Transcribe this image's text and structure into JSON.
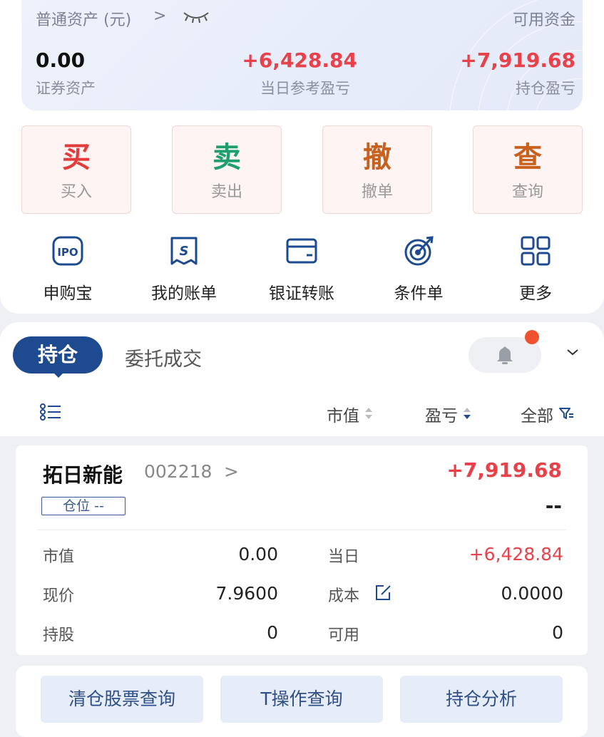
{
  "asset_summary": {
    "account_type_label": "普通资产 (元)",
    "chevron": ">",
    "available_funds_label": "可用资金",
    "securities_assets_value": "0.00",
    "securities_assets_label": "证券资产",
    "daily_pl_value": "+6,428.84",
    "daily_pl_label": "当日参考盈亏",
    "holding_pl_value": "+7,919.68",
    "holding_pl_label": "持仓盈亏"
  },
  "actions": [
    {
      "big": "买",
      "small": "买入",
      "color": "#e23c3c"
    },
    {
      "big": "卖",
      "small": "卖出",
      "color": "#1f9f6c"
    },
    {
      "big": "撤",
      "small": "撤单",
      "color": "#c8611e"
    },
    {
      "big": "查",
      "small": "查询",
      "color": "#c8611e"
    }
  ],
  "tools": [
    {
      "icon": "ipo-icon",
      "icon_text": "IPO",
      "label": "申购宝"
    },
    {
      "icon": "bill-icon",
      "icon_text": "S",
      "label": "我的账单"
    },
    {
      "icon": "wallet-icon",
      "label": "银证转账"
    },
    {
      "icon": "target-icon",
      "label": "条件单"
    },
    {
      "icon": "grid-icon",
      "label": "更多"
    }
  ],
  "tabs": {
    "active": "持仓",
    "inactive": "委托成交"
  },
  "column_headers": {
    "market_value": "市值",
    "profit_loss": "盈亏",
    "filter_all": "全部"
  },
  "position": {
    "name": "拓日新能",
    "code": "002218",
    "chevron": ">",
    "total_pl": "+7,919.68",
    "position_badge": "仓位 --",
    "pl_ratio": "--",
    "rows": {
      "market_value_label": "市值",
      "market_value": "0.00",
      "today_label": "当日",
      "today_value": "+6,428.84",
      "price_label": "现价",
      "price_value": "7.9600",
      "cost_label": "成本",
      "cost_value": "0.0000",
      "shares_label": "持股",
      "shares_value": "0",
      "available_label": "可用",
      "available_value": "0"
    }
  },
  "bottom_buttons": [
    "清仓股票查询",
    "T操作查询",
    "持仓分析"
  ],
  "colors": {
    "profit_red": "#e8414a",
    "brand_blue": "#1e4b8f",
    "notification_dot": "#f0522f"
  }
}
